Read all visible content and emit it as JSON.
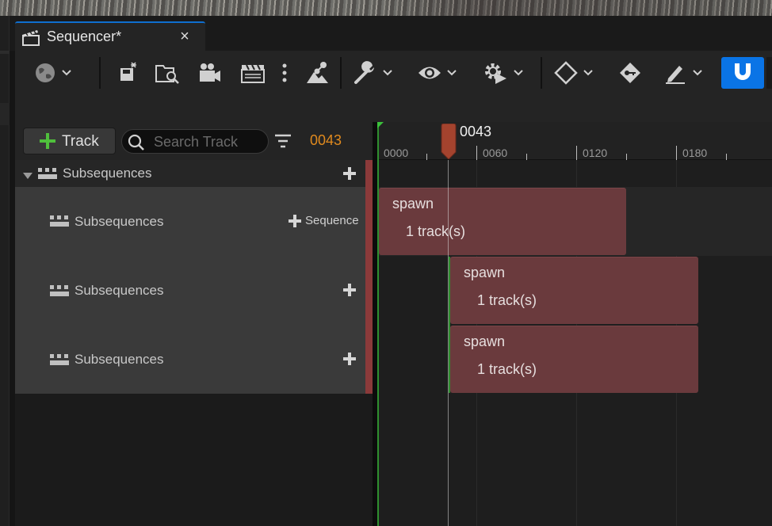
{
  "tab": {
    "title": "Sequencer*",
    "close": "×"
  },
  "toolbar": {
    "items": [
      "world-icon",
      "save-icon",
      "browse-icon",
      "camera-icon",
      "clapper-icon",
      "more-icon",
      "hierarchy-icon",
      "wrench-icon",
      "eye-icon",
      "playback-gear-icon",
      "key-diamond-icon",
      "key-icon",
      "pen-icon",
      "snap-magnet-icon"
    ],
    "accent": "#0a74e6"
  },
  "outliner": {
    "add_track_label": "Track",
    "search_placeholder": "Search Track",
    "current_frame": "0043",
    "frame_color": "#e08a1e",
    "root": {
      "label": "Subsequences"
    },
    "rows": [
      {
        "label": "Subsequences",
        "add_label": "Sequence"
      },
      {
        "label": "Subsequences"
      },
      {
        "label": "Subsequences"
      }
    ]
  },
  "timeline": {
    "playhead_frame": "0043",
    "ticks": [
      "0000",
      "0060",
      "0120",
      "0180"
    ],
    "sections": [
      {
        "name": "spawn",
        "count": "1 track(s)"
      },
      {
        "name": "spawn",
        "count": "1 track(s)"
      },
      {
        "name": "spawn",
        "count": "1 track(s)"
      }
    ],
    "section_color": "#6a3a3d"
  }
}
